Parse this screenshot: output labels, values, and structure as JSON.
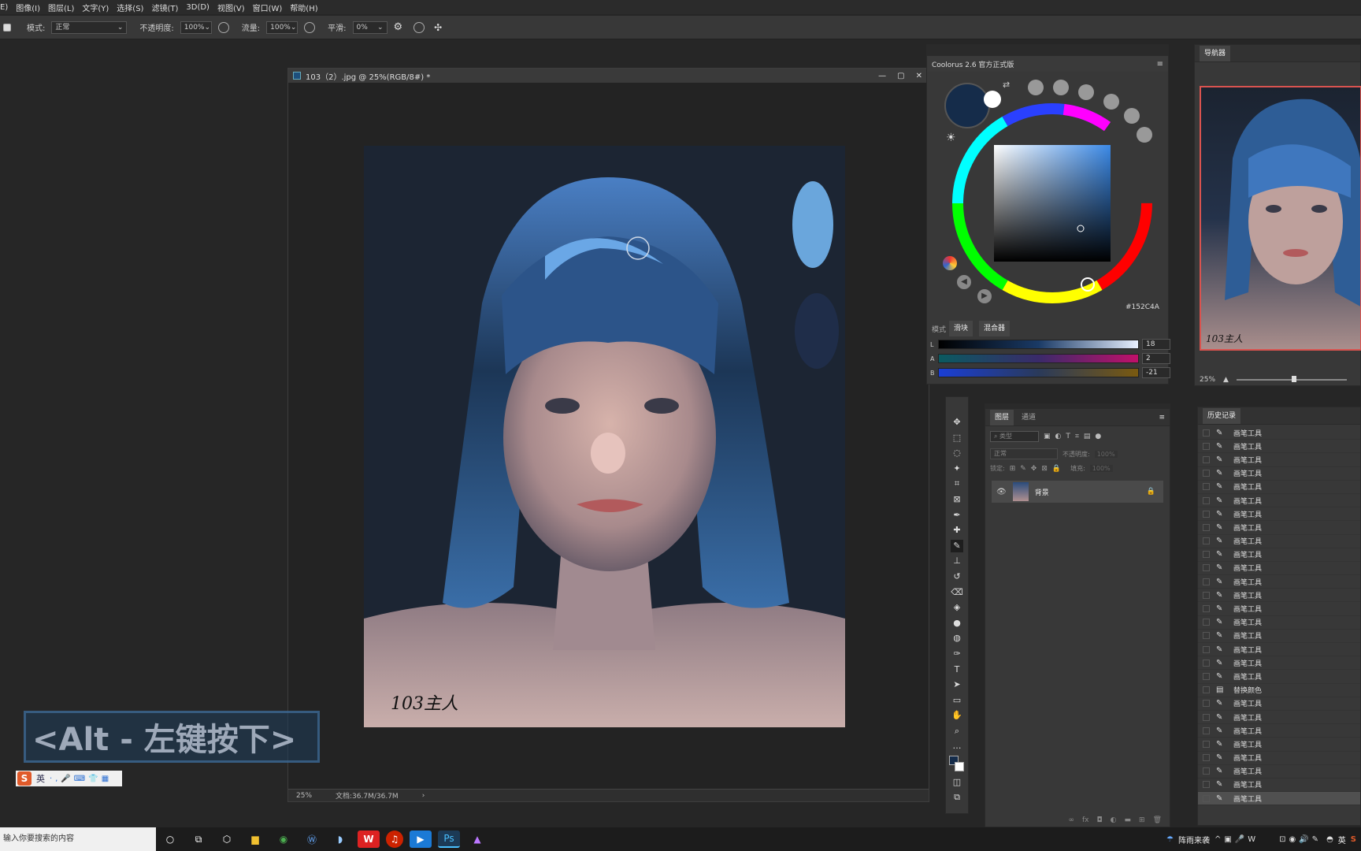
{
  "menu": [
    "E)",
    "图像(I)",
    "图层(L)",
    "文字(Y)",
    "选择(S)",
    "滤镜(T)",
    "3D(D)",
    "视图(V)",
    "窗口(W)",
    "帮助(H)"
  ],
  "options": {
    "mode_label": "模式:",
    "mode_value": "正常",
    "opacity_label": "不透明度:",
    "opacity_value": "100%",
    "flow_label": "流量:",
    "flow_value": "100%",
    "smooth_label": "平滑:",
    "smooth_value": "0%"
  },
  "document": {
    "title": "103（2）.jpg @ 25%(RGB/8#) *",
    "zoom": "25%",
    "doc_size": "文档:36.7M/36.7M",
    "signature": "103主人"
  },
  "coolorus": {
    "title": "Coolorus 2.6 官方正式版",
    "hex": "152C4A",
    "mode_label": "模式",
    "tab_slider": "滑块",
    "tab_mixer": "混合器",
    "sliders": [
      {
        "name": "L",
        "value": "18"
      },
      {
        "name": "A",
        "value": "2"
      },
      {
        "name": "B",
        "value": "-21"
      }
    ],
    "current_color": "#152C4A"
  },
  "navigator": {
    "title": "导航器",
    "zoom": "25%",
    "signature": "103主人"
  },
  "layers": {
    "tab_layers": "图层",
    "tab_channels": "通道",
    "filter_placeholder": "类型",
    "blend": "正常",
    "opacity_label": "不透明度:",
    "opacity_value": "100%",
    "lock_label": "锁定:",
    "fill_label": "填充:",
    "fill_value": "100%",
    "layer_name": "背景"
  },
  "history": {
    "title": "历史记录",
    "items": [
      "画笔工具",
      "画笔工具",
      "画笔工具",
      "画笔工具",
      "画笔工具",
      "画笔工具",
      "画笔工具",
      "画笔工具",
      "画笔工具",
      "画笔工具",
      "画笔工具",
      "画笔工具",
      "画笔工具",
      "画笔工具",
      "画笔工具",
      "画笔工具",
      "画笔工具",
      "画笔工具",
      "画笔工具",
      "替换颜色",
      "画笔工具",
      "画笔工具",
      "画笔工具",
      "画笔工具",
      "画笔工具",
      "画笔工具",
      "画笔工具",
      "画笔工具"
    ]
  },
  "overlay": {
    "shortcut": "<Alt - 左键按下>",
    "ime_lang": "英"
  },
  "taskbar": {
    "search": "输入你要搜索的内容",
    "weather": "阵雨来袭",
    "lang": "英"
  }
}
